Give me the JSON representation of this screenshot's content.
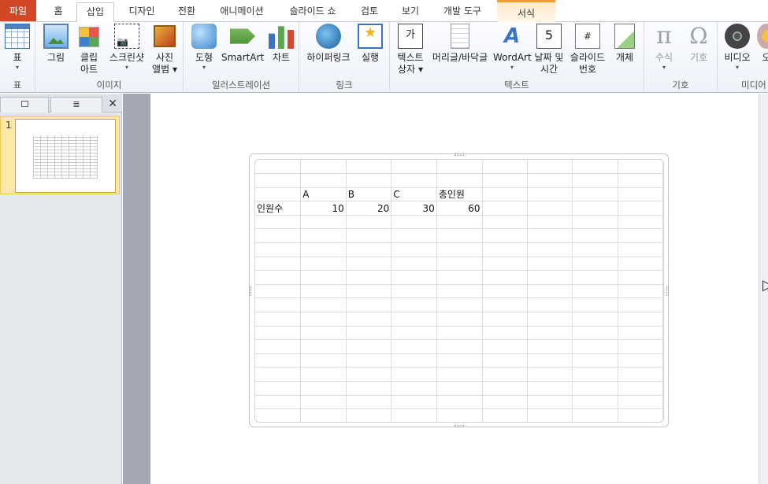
{
  "tabs": [
    {
      "label": "파일"
    },
    {
      "label": "홈"
    },
    {
      "label": "삽입"
    },
    {
      "label": "디자인"
    },
    {
      "label": "전환"
    },
    {
      "label": "애니메이션"
    },
    {
      "label": "슬라이드 쇼"
    },
    {
      "label": "검토"
    },
    {
      "label": "보기"
    },
    {
      "label": "개발 도구"
    },
    {
      "label": "서식"
    }
  ],
  "ribbon": {
    "groups": {
      "table": "표",
      "images": "이미지",
      "illustrations": "일러스트레이션",
      "links": "링크",
      "text": "텍스트",
      "symbols": "기호",
      "media": "미디어"
    },
    "buttons": {
      "table": "표",
      "picture": "그림",
      "clipart_1": "클립",
      "clipart_2": "아트",
      "screenshot": "스크린샷",
      "album_1": "사진",
      "album_2": "앨범",
      "shapes": "도형",
      "smartart": "SmartArt",
      "chart": "차트",
      "hyperlink": "하이퍼링크",
      "action": "실행",
      "textbox_1": "텍스트",
      "textbox_2": "상자",
      "header_footer": "머리글/바닥글",
      "wordart": "WordArt",
      "datetime_1": "날짜 및",
      "datetime_2": "시간",
      "slidenum_1": "슬라이드",
      "slidenum_2": "번호",
      "object": "개체",
      "equation": "수식",
      "symbol": "기호",
      "video": "비디오",
      "audio": "오"
    },
    "icons": {
      "textbox_glyph": "가",
      "date_glyph": "5",
      "slidenum_glyph": "#",
      "equation_glyph": "π",
      "symbol_glyph": "Ω"
    }
  },
  "left_pane": {
    "slide_number": "1",
    "close": "✕"
  },
  "sheet": {
    "rows": [
      [
        "",
        "",
        "",
        "",
        "",
        "",
        "",
        "",
        ""
      ],
      [
        "",
        "",
        "",
        "",
        "",
        "",
        "",
        "",
        ""
      ],
      [
        "",
        "A",
        "B",
        "C",
        "총인원",
        "",
        "",
        "",
        ""
      ],
      [
        "인원수",
        "10",
        "20",
        "30",
        "60",
        "",
        "",
        "",
        ""
      ],
      [
        "",
        "",
        "",
        "",
        "",
        "",
        "",
        "",
        ""
      ],
      [
        "",
        "",
        "",
        "",
        "",
        "",
        "",
        "",
        ""
      ],
      [
        "",
        "",
        "",
        "",
        "",
        "",
        "",
        "",
        ""
      ],
      [
        "",
        "",
        "",
        "",
        "",
        "",
        "",
        "",
        ""
      ],
      [
        "",
        "",
        "",
        "",
        "",
        "",
        "",
        "",
        ""
      ],
      [
        "",
        "",
        "",
        "",
        "",
        "",
        "",
        "",
        ""
      ],
      [
        "",
        "",
        "",
        "",
        "",
        "",
        "",
        "",
        ""
      ],
      [
        "",
        "",
        "",
        "",
        "",
        "",
        "",
        "",
        ""
      ],
      [
        "",
        "",
        "",
        "",
        "",
        "",
        "",
        "",
        ""
      ],
      [
        "",
        "",
        "",
        "",
        "",
        "",
        "",
        "",
        ""
      ],
      [
        "",
        "",
        "",
        "",
        "",
        "",
        "",
        "",
        ""
      ],
      [
        "",
        "",
        "",
        "",
        "",
        "",
        "",
        "",
        ""
      ],
      [
        "",
        "",
        "",
        "",
        "",
        "",
        "",
        "",
        ""
      ],
      [
        "",
        "",
        "",
        "",
        "",
        "",
        "",
        "",
        ""
      ],
      [
        "",
        "",
        "",
        "",
        "",
        "",
        "",
        "",
        ""
      ]
    ],
    "numeric_cols": [
      1,
      2,
      3,
      4
    ],
    "numeric_rows": [
      3
    ]
  },
  "colors": {
    "file_tab": "#d24726",
    "context_tab_accent": "#f0a030",
    "thumb_selected": "#fde9a5"
  }
}
